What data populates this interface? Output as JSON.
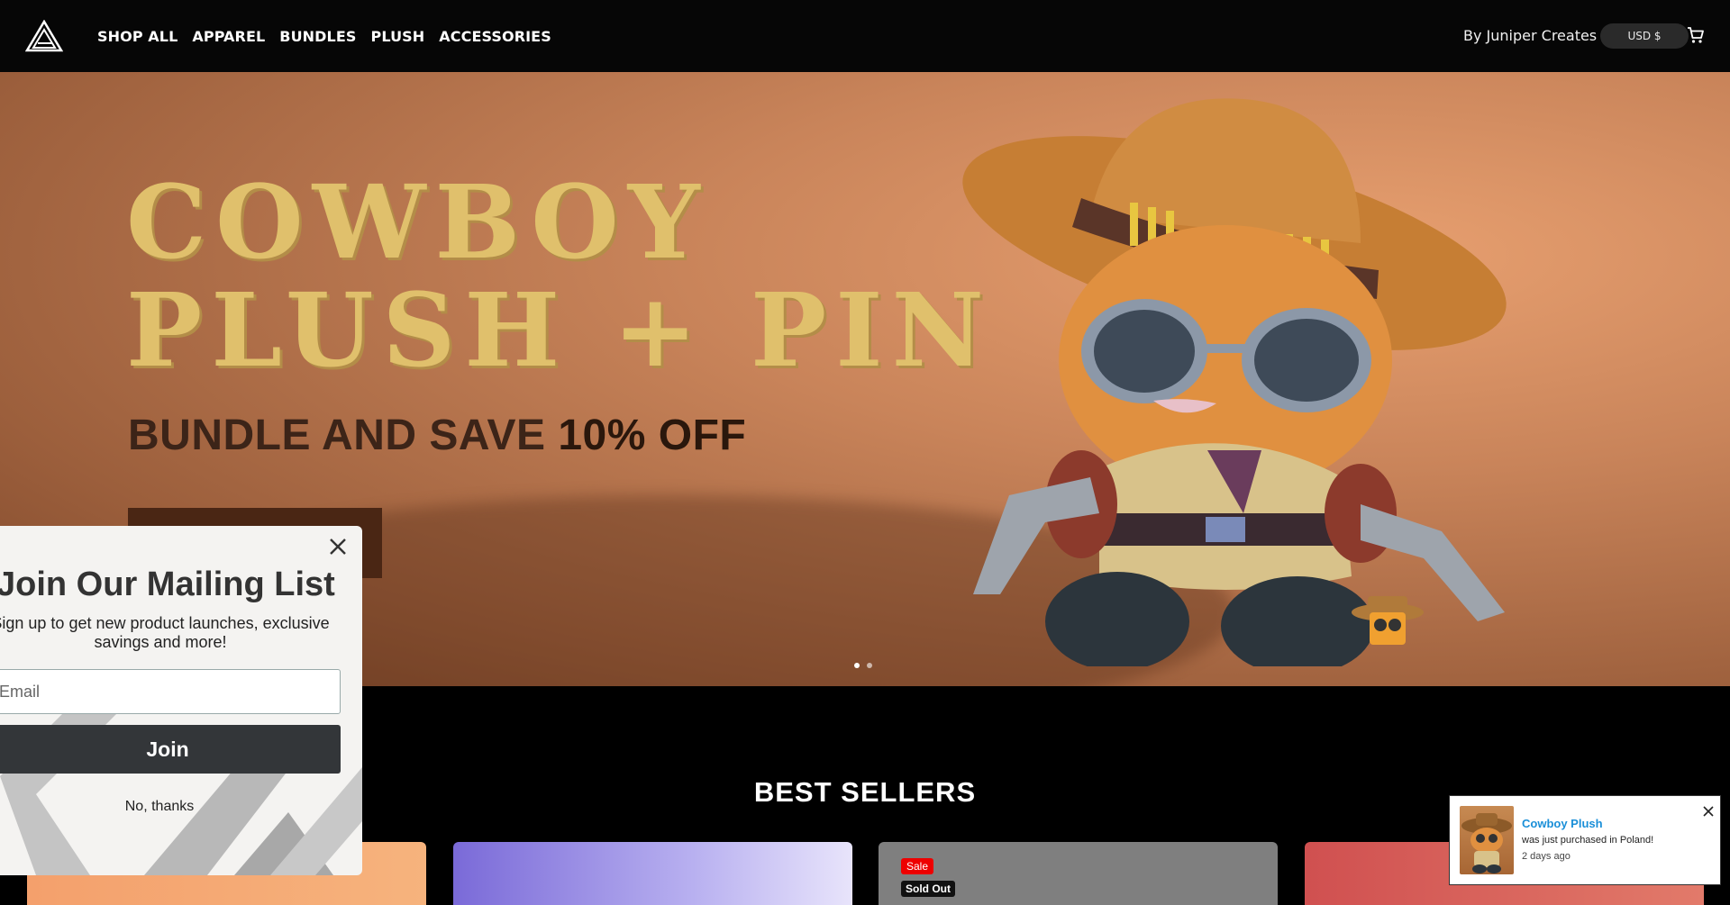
{
  "header": {
    "logo_icon": "triangle-logo-icon",
    "nav": [
      "SHOP ALL",
      "APPAREL",
      "BUNDLES",
      "PLUSH",
      "ACCESSORIES"
    ],
    "brand_link": "By Juniper Creates",
    "currency": "USD $",
    "cart_icon": "cart-icon"
  },
  "hero": {
    "title_line1": "COWBOY",
    "title_line2": "PLUSH + PIN",
    "subtitle_prefix": "BUNDLE AND SAVE ",
    "subtitle_emph": "10% OFF",
    "slides_total": 2,
    "slide_active": 1,
    "colors": {
      "title": "#e0c06c",
      "subtitle": "#3c2418"
    }
  },
  "section": {
    "best_sellers": "BEST SELLERS"
  },
  "cards": {
    "badges": {
      "sale": "Sale",
      "sold_out": "Sold Out"
    }
  },
  "popup": {
    "title": "Join Our Mailing List",
    "description": "Sign up to get new product launches, exclusive savings and more!",
    "email_placeholder": "Email",
    "join_label": "Join",
    "decline_label": "No, thanks",
    "close_icon": "close-icon"
  },
  "notification": {
    "product": "Cowboy Plush",
    "text": "was just purchased in Poland!",
    "time": "2 days ago",
    "close_icon": "close-icon"
  }
}
